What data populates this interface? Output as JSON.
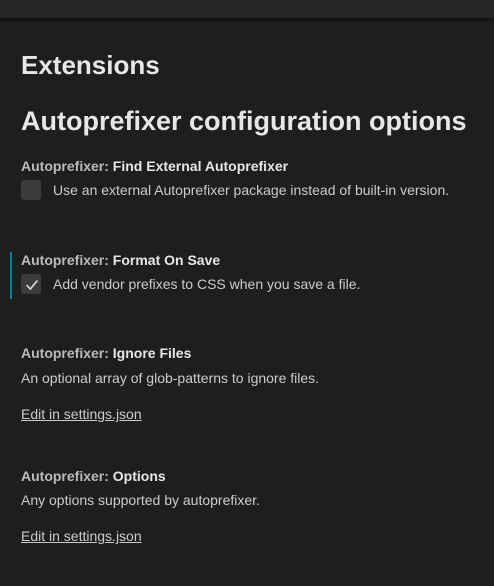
{
  "header": {
    "section_title": "Extensions",
    "group_title": "Autoprefixer configuration options"
  },
  "settings": [
    {
      "category": "Autoprefixer: ",
      "key": "Find External Autoprefixer",
      "description": "Use an external Autoprefixer package instead of built-in version.",
      "type": "checkbox",
      "checked": false
    },
    {
      "category": "Autoprefixer: ",
      "key": "Format On Save",
      "description": "Add vendor prefixes to CSS when you save a file.",
      "type": "checkbox",
      "checked": true,
      "modified": true
    },
    {
      "category": "Autoprefixer: ",
      "key": "Ignore Files",
      "description": "An optional array of glob-patterns to ignore files.",
      "type": "link",
      "link_label": "Edit in settings.json"
    },
    {
      "category": "Autoprefixer: ",
      "key": "Options",
      "description": "Any options supported by autoprefixer.",
      "type": "link",
      "link_label": "Edit in settings.json"
    }
  ],
  "colors": {
    "background": "#1e1e1e",
    "modified_indicator": "#0c7d9d",
    "checkbox_bg": "#3c3c3c"
  },
  "icons": {
    "check": "check-icon"
  }
}
